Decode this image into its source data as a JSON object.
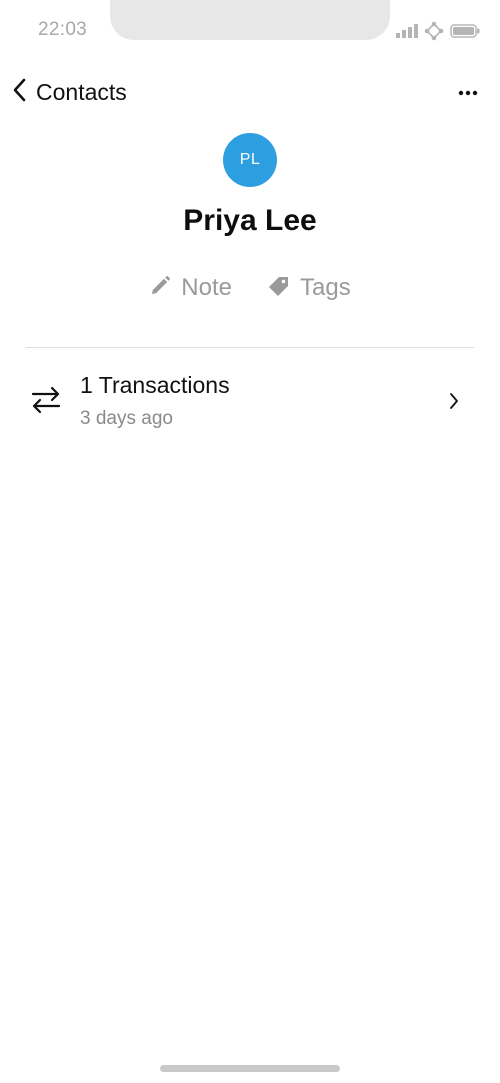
{
  "status_bar": {
    "time": "22:03",
    "icons": [
      "signal-icon",
      "wifi-icon",
      "battery-icon"
    ]
  },
  "nav": {
    "back_label": "Contacts",
    "back_icon": "chevron-left-icon",
    "more_icon": "ellipsis-icon"
  },
  "contact": {
    "initials": "PL",
    "name": "Priya Lee",
    "avatar_color": "#2d9fe0"
  },
  "actions": [
    {
      "label": "Note",
      "icon": "pencil-icon"
    },
    {
      "label": "Tags",
      "icon": "tag-icon"
    }
  ],
  "transactions": {
    "title": "1 Transactions",
    "subtitle": "3 days ago",
    "icon": "transfer-arrows-icon"
  }
}
